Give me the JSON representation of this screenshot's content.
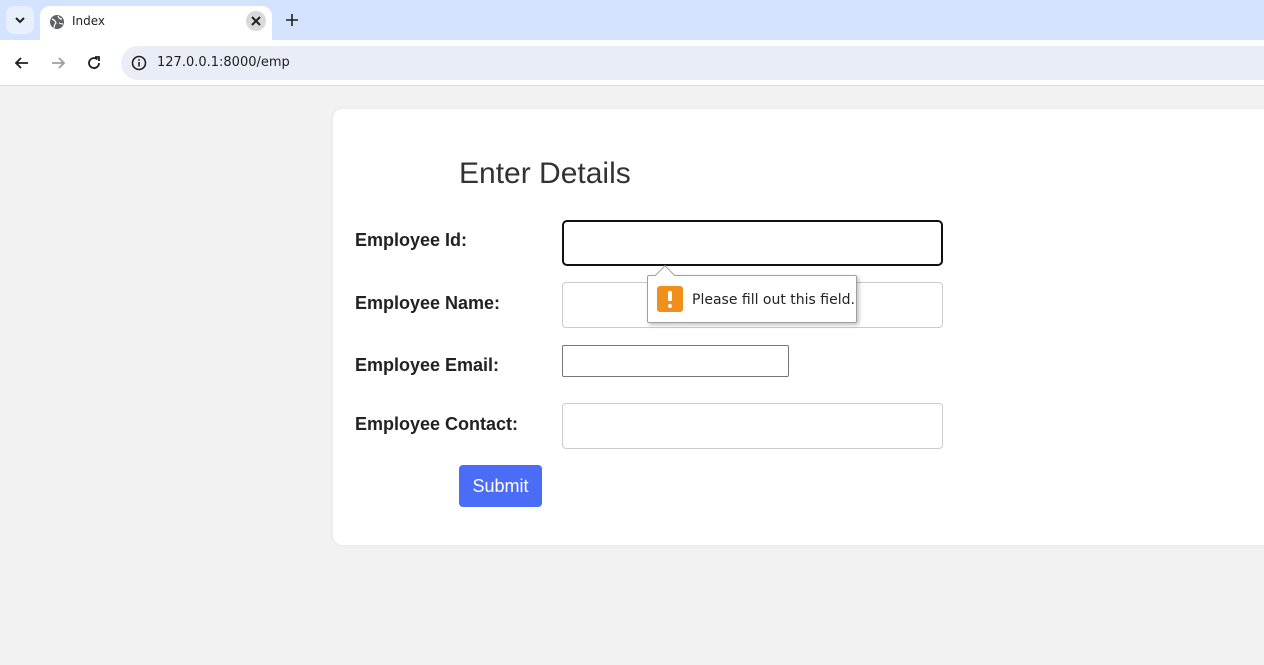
{
  "browser": {
    "tab_title": "Index",
    "url": "127.0.0.1:8000/emp"
  },
  "form": {
    "heading": "Enter Details",
    "fields": [
      {
        "label": "Employee Id:",
        "value": ""
      },
      {
        "label": "Employee Name:",
        "value": ""
      },
      {
        "label": "Employee Email:",
        "value": ""
      },
      {
        "label": "Employee Contact:",
        "value": ""
      }
    ],
    "submit_label": "Submit"
  },
  "validation": {
    "message": "Please fill out this field."
  },
  "colors": {
    "submit_button": "#4a6cf7",
    "warning_icon": "#f18f1d",
    "tab_strip": "#d3e3fd"
  },
  "icons": {
    "tab_list": "chevron-down-icon",
    "tab_favicon": "globe-icon",
    "tab_close": "close-icon",
    "new_tab": "plus-icon",
    "back": "arrow-left-icon",
    "forward": "arrow-right-icon",
    "reload": "reload-icon",
    "site_info": "info-icon",
    "warning": "warning-icon"
  }
}
